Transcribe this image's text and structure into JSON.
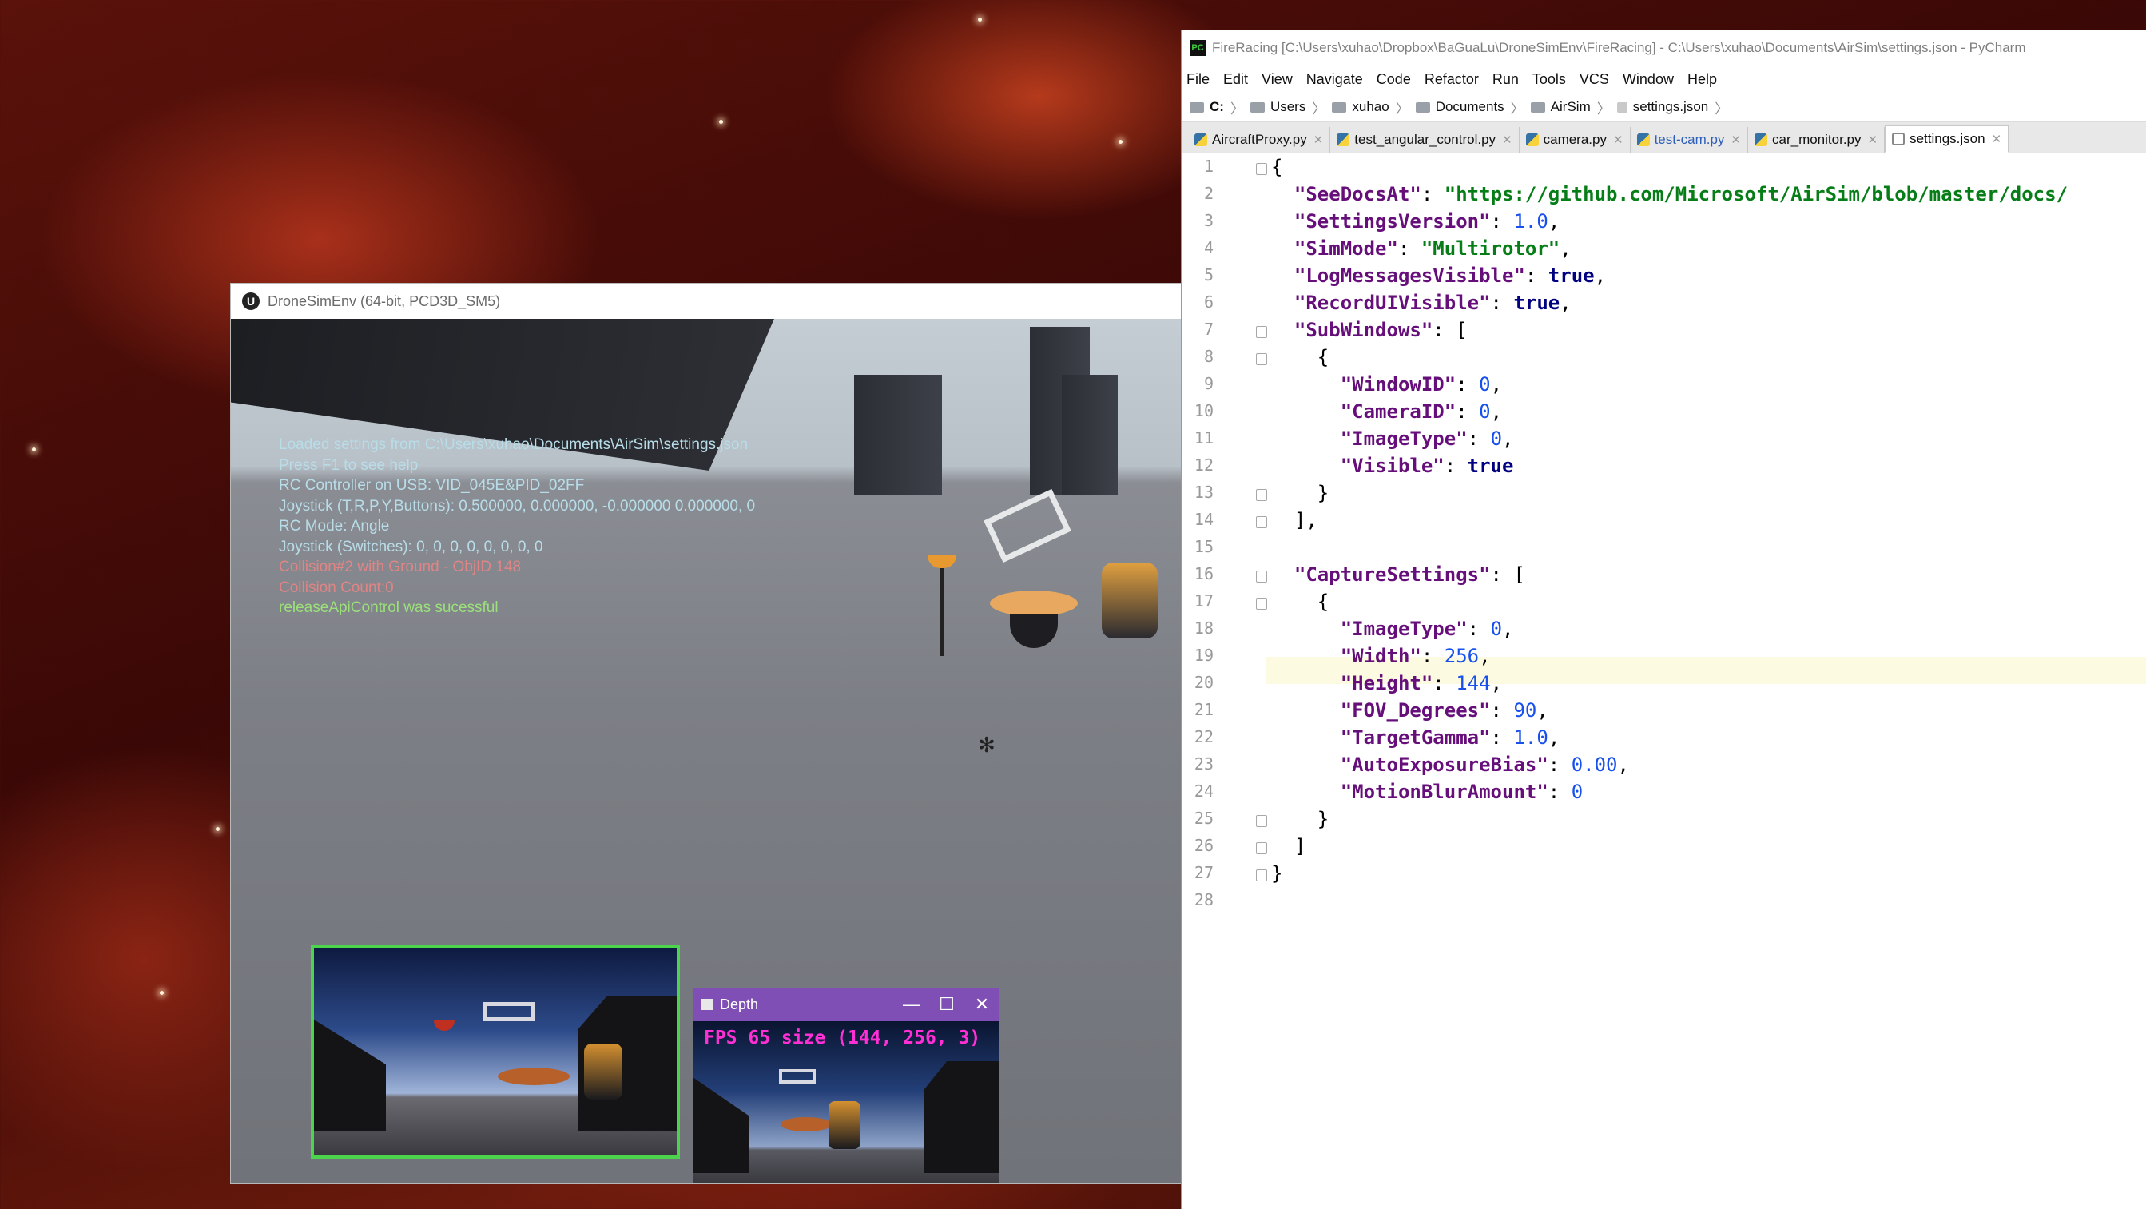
{
  "ue_window": {
    "title": "DroneSimEnv (64-bit, PCD3D_SM5)",
    "overlay": {
      "line1": "Loaded settings from C:\\Users\\xuhao\\Documents\\AirSim\\settings.json",
      "line2": "Press F1 to see help",
      "line3": "RC Controller on USB: VID_045E&PID_02FF",
      "line4": "Joystick (T,R,P,Y,Buttons): 0.500000, 0.000000, -0.000000 0.000000, 0",
      "line5": "RC Mode: Angle",
      "line6": "Joystick (Switches): 0, 0, 0, 0, 0, 0, 0, 0",
      "line7": "Collision#2 with Ground - ObjID 148",
      "line8": "Collision Count:0",
      "line9": "releaseApiControl was sucessful"
    }
  },
  "depth_window": {
    "title": "Depth",
    "fps_text": "FPS 65 size (144, 256, 3)",
    "minimize": "—",
    "maximize": "☐",
    "close": "✕"
  },
  "pycharm": {
    "title": "FireRacing [C:\\Users\\xuhao\\Dropbox\\BaGuaLu\\DroneSimEnv\\FireRacing] - C:\\Users\\xuhao\\Documents\\AirSim\\settings.json - PyCharm",
    "menu": [
      "File",
      "Edit",
      "View",
      "Navigate",
      "Code",
      "Refactor",
      "Run",
      "Tools",
      "VCS",
      "Window",
      "Help"
    ],
    "breadcrumb": [
      "C:",
      "Users",
      "xuhao",
      "Documents",
      "AirSim",
      "settings.json"
    ],
    "tabs": [
      {
        "label": "AircraftProxy.py"
      },
      {
        "label": "test_angular_control.py"
      },
      {
        "label": "camera.py"
      },
      {
        "label": "test-cam.py"
      },
      {
        "label": "car_monitor.py"
      },
      {
        "label": "settings.json"
      }
    ],
    "active_tab": "settings.json",
    "highlighted_line": 19,
    "line_numbers": [
      "1",
      "2",
      "3",
      "4",
      "5",
      "6",
      "7",
      "8",
      "9",
      "10",
      "11",
      "12",
      "13",
      "14",
      "15",
      "16",
      "17",
      "18",
      "19",
      "20",
      "21",
      "22",
      "23",
      "24",
      "25",
      "26",
      "27",
      "28"
    ],
    "code": {
      "l1": "{",
      "l2_key": "\"SeeDocsAt\"",
      "l2_val": "\"https://github.com/Microsoft/AirSim/blob/master/docs/",
      "l3_key": "\"SettingsVersion\"",
      "l3_val": "1.0",
      "l4_key": "\"SimMode\"",
      "l4_val": "\"Multirotor\"",
      "l5_key": "\"LogMessagesVisible\"",
      "l5_val": "true",
      "l6_key": "\"RecordUIVisible\"",
      "l6_val": "true",
      "l7_key": "\"SubWindows\"",
      "l7_val": "[",
      "l8": "{",
      "l9_key": "\"WindowID\"",
      "l9_val": "0",
      "l10_key": "\"CameraID\"",
      "l10_val": "0",
      "l11_key": "\"ImageType\"",
      "l11_val": "0",
      "l12_key": "\"Visible\"",
      "l12_val": "true",
      "l13": "}",
      "l14": "],",
      "l16_key": "\"CaptureSettings\"",
      "l16_val": "[",
      "l17": "{",
      "l18_key": "\"ImageType\"",
      "l18_val": "0",
      "l19_key": "\"Width\"",
      "l19_val": "256",
      "l20_key": "\"Height\"",
      "l20_val": "144",
      "l21_key": "\"FOV_Degrees\"",
      "l21_val": "90",
      "l22_key": "\"TargetGamma\"",
      "l22_val": "1.0",
      "l23_key": "\"AutoExposureBias\"",
      "l23_val": "0.00",
      "l24_key": "\"MotionBlurAmount\"",
      "l24_val": "0",
      "l25": "}",
      "l26": "]",
      "l27": "}"
    }
  }
}
